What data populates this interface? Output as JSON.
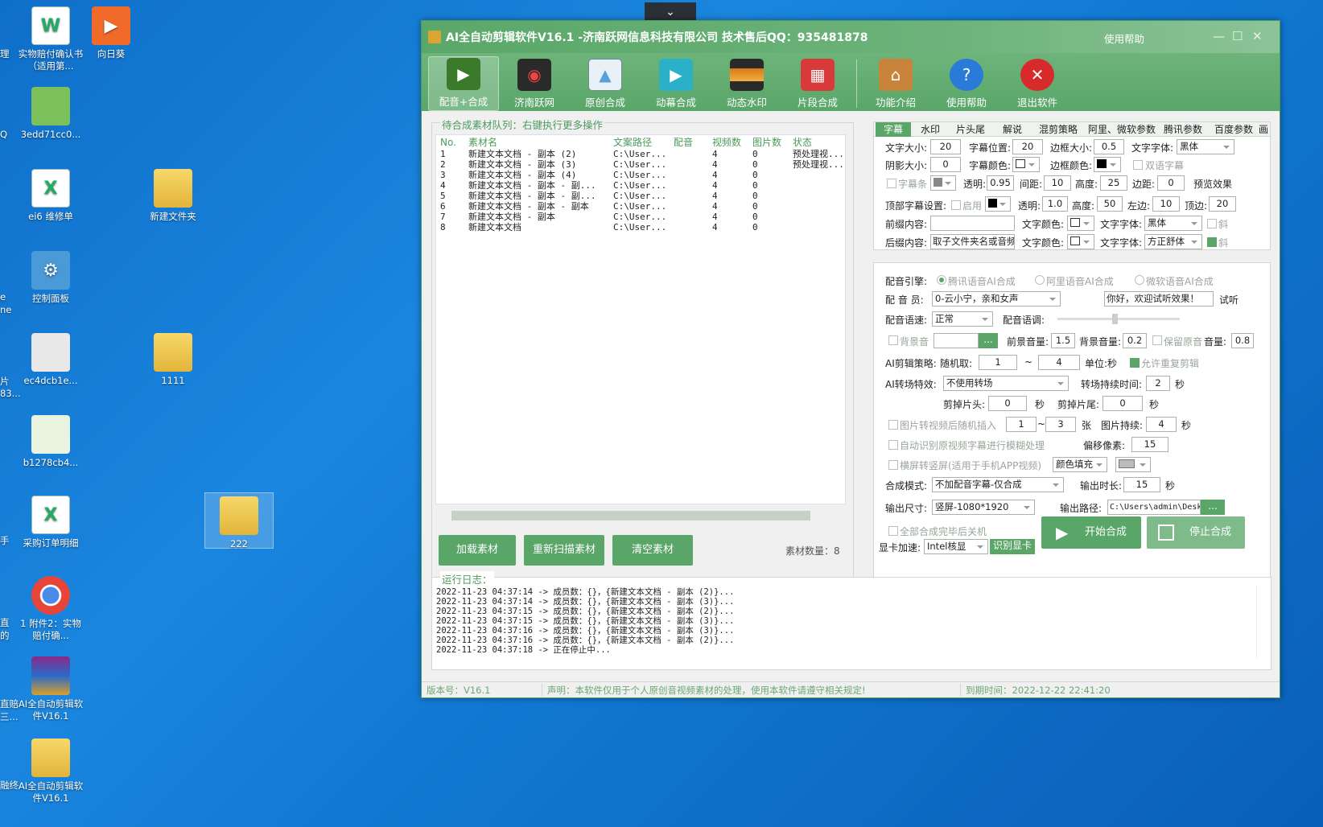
{
  "desktop": {
    "icons": [
      {
        "label": "实物赔付确认书（适用第...",
        "type": "doc"
      },
      {
        "label": "向日葵",
        "type": "app"
      },
      {
        "label": "3edd71cc0...",
        "type": "img"
      },
      {
        "label": "ei6 维修单",
        "type": "doc"
      },
      {
        "label": "新建文件夹",
        "type": "folder"
      },
      {
        "label": "控制面板",
        "type": "app"
      },
      {
        "label": "ec4dcb1e...",
        "type": "img"
      },
      {
        "label": "1111",
        "type": "folder"
      },
      {
        "label": "b1278cb4...",
        "type": "img"
      },
      {
        "label": "222",
        "type": "folder"
      },
      {
        "label": "采购订单明细",
        "type": "doc"
      },
      {
        "label": "1 附件2：实物赔付确...",
        "type": "app"
      },
      {
        "label": "AI全自动剪辑软件V16.1",
        "type": "app"
      },
      {
        "label": "AI全自动剪辑软件V16.1",
        "type": "folder"
      }
    ],
    "cutoff_labels": [
      "理",
      "Q",
      "e",
      "ne",
      "片",
      "83...",
      "手",
      "直",
      "的",
      "直赔",
      "三...",
      "融终"
    ]
  },
  "window": {
    "title": "AI全自动剪辑软件V16.1 -济南跃网信息科技有限公司 技术售后QQ：935481878",
    "help": "使用帮助",
    "min": "—",
    "max": "☐",
    "close": "✕"
  },
  "toolbar": [
    {
      "label": "配音+合成",
      "icon": "clapper-icon",
      "color": "#3a7a2a"
    },
    {
      "label": "济南跃网",
      "icon": "film-reel-icon",
      "color": "#2a2a2a"
    },
    {
      "label": "原创合成",
      "icon": "picture-icon",
      "color": "#5aa0d8"
    },
    {
      "label": "动幕合成",
      "icon": "play-video-icon",
      "color": "#2ab0c8"
    },
    {
      "label": "动态水印",
      "icon": "sunset-icon",
      "color": "#d87a1a"
    },
    {
      "label": "片段合成",
      "icon": "film-strip-icon",
      "color": "#d83a3a"
    },
    {
      "label": "功能介绍",
      "icon": "home-icon",
      "color": "#c8843a"
    },
    {
      "label": "使用帮助",
      "icon": "help-icon",
      "color": "#2a7ad8"
    },
    {
      "label": "退出软件",
      "icon": "exit-icon",
      "color": "#d82a2a"
    }
  ],
  "queue": {
    "legend": "待合成素材队列：右键执行更多操作",
    "columns": [
      "No.",
      "素材名",
      "文案路径",
      "配音",
      "视频数",
      "图片数",
      "状态"
    ],
    "rows": [
      [
        "1",
        "新建文本文档 - 副本 (2)",
        "C:\\User...",
        "",
        "4",
        "0",
        "预处理视..."
      ],
      [
        "2",
        "新建文本文档 - 副本 (3)",
        "C:\\User...",
        "",
        "4",
        "0",
        "预处理视..."
      ],
      [
        "3",
        "新建文本文档 - 副本 (4)",
        "C:\\User...",
        "",
        "4",
        "0",
        ""
      ],
      [
        "4",
        "新建文本文档 - 副本 - 副...",
        "C:\\User...",
        "",
        "4",
        "0",
        ""
      ],
      [
        "5",
        "新建文本文档 - 副本 - 副...",
        "C:\\User...",
        "",
        "4",
        "0",
        ""
      ],
      [
        "6",
        "新建文本文档 - 副本 - 副本",
        "C:\\User...",
        "",
        "4",
        "0",
        ""
      ],
      [
        "7",
        "新建文本文档 - 副本",
        "C:\\User...",
        "",
        "4",
        "0",
        ""
      ],
      [
        "8",
        "新建文本文档",
        "C:\\User...",
        "",
        "4",
        "0",
        ""
      ]
    ],
    "load_btn": "加载素材",
    "rescan_btn": "重新扫描素材",
    "clear_btn": "清空素材",
    "count": "素材数量：8"
  },
  "log": {
    "legend": "运行日志：",
    "lines": [
      "2022-11-23 04:37:14 -> 成员数：{}，{新建文本文档 - 副本 (2)}...",
      "2022-11-23 04:37:14 -> 成员数：{}，{新建文本文档 - 副本 (3)}...",
      "2022-11-23 04:37:15 -> 成员数：{}，{新建文本文档 - 副本 (2)}...",
      "2022-11-23 04:37:15 -> 成员数：{}，{新建文本文档 - 副本 (3)}...",
      "2022-11-23 04:37:16 -> 成员数：{}，{新建文本文档 - 副本 (3)}...",
      "2022-11-23 04:37:16 -> 成员数：{}，{新建文本文档 - 副本 (2)}...",
      "2022-11-23 04:37:18 -> 正在停止中..."
    ]
  },
  "tabs": [
    "字幕",
    "水印",
    "片头尾",
    "解说",
    "混剪策略",
    "阿里、微软参数",
    "腾讯参数",
    "百度参数",
    "画"
  ],
  "subtitle": {
    "font_size_l": "文字大小:",
    "font_size": "20",
    "pos_l": "字幕位置:",
    "pos": "20",
    "border_l": "边框大小:",
    "border": "0.5",
    "font_l": "文字字体:",
    "font": "黑体",
    "shadow_l": "阴影大小:",
    "shadow": "0",
    "color_l": "字幕颜色:",
    "bcolor_l": "边框颜色:",
    "dual": "双语字幕",
    "bar": "字幕条",
    "alpha_l": "透明:",
    "alpha": "0.95",
    "gap_l": "间距:",
    "gap": "10",
    "height_l": "高度:",
    "height": "25",
    "margin_l": "边距:",
    "margin": "0",
    "preview": "预览效果",
    "top_l": "顶部字幕设置:",
    "enable": "启用",
    "talpha_l": "透明:",
    "talpha": "1.0",
    "theight_l": "高度:",
    "theight": "50",
    "left_l": "左边:",
    "left": "10",
    "topm_l": "顶边:",
    "topm": "20",
    "prefix_l": "前缀内容:",
    "prefix": "",
    "pcolor_l": "文字颜色:",
    "pfont_l": "文字字体:",
    "pfont": "黑体",
    "italic": "斜",
    "suffix_l": "后缀内容:",
    "suffix": "取子文件夹名或音频",
    "scolor_l": "文字颜色:",
    "sfont_l": "文字字体:",
    "sfont": "方正舒体",
    "sitalic": "斜"
  },
  "voice": {
    "engine_l": "配音引擎:",
    "engine_opts": [
      "腾讯语音AI合成",
      "阿里语音AI合成",
      "微软语音AI合成"
    ],
    "voicer_l": "配 音 员:",
    "voicer": "0-云小宁，亲和女声",
    "test_text": "你好，欢迎试听效果！",
    "test_btn": "试听",
    "speed_l": "配音语速:",
    "speed": "正常",
    "tone_l": "配音语调:",
    "bgm": "背景音",
    "bgm_btn": "...",
    "fg_vol_l": "前景音量:",
    "fg_vol": "1.5",
    "bg_vol_l": "背景音量:",
    "bg_vol": "0.2",
    "keep": "保留原音",
    "vol_l": "音量:",
    "vol": "0.8",
    "clip_l": "AI剪辑策略:",
    "rand_l": "随机取:",
    "rand_min": "1",
    "dash": "~",
    "rand_max": "4",
    "unit": "单位:秒",
    "allow_repeat": "允许重复剪辑",
    "trans_l": "AI转场特效:",
    "trans": "不使用转场",
    "trans_dur_l": "转场持续时间:",
    "trans_dur": "2",
    "sec": "秒",
    "cut_head_l": "剪掉片头:",
    "cut_head": "0",
    "cut_tail_l": "剪掉片尾:",
    "cut_tail": "0",
    "img_insert": "图片转视频后随机插入",
    "img_min": "1",
    "img_max": "3",
    "zhang": "张",
    "img_dur_l": "图片持续:",
    "img_dur": "4",
    "blur": "自动识别原视频字幕进行模糊处理",
    "offset_l": "偏移像素:",
    "offset": "15",
    "portrait": "横屏转竖屏(适用于手机APP视频)",
    "fill": "颜色填充",
    "mode_l": "合成模式:",
    "mode": "不加配音字幕-仅合成",
    "out_dur_l": "输出时长:",
    "out_dur": "15",
    "size_l": "输出尺寸:",
    "size": "竖屏-1080*1920",
    "path_l": "输出路径:",
    "path": "C:\\Users\\admin\\Desktop\\",
    "shutdown": "全部合成完毕后关机",
    "gpu_l": "显卡加速:",
    "gpu": "Intel核显",
    "gpu_btn": "识别显卡",
    "start": "开始合成",
    "stop": "停止合成"
  },
  "status": {
    "version": "版本号：V16.1",
    "notice": "声明：本软件仅用于个人原创音视频素材的处理，使用本软件请遵守相关规定!",
    "expire": "到期时间：2022-12-22 22:41:20"
  }
}
